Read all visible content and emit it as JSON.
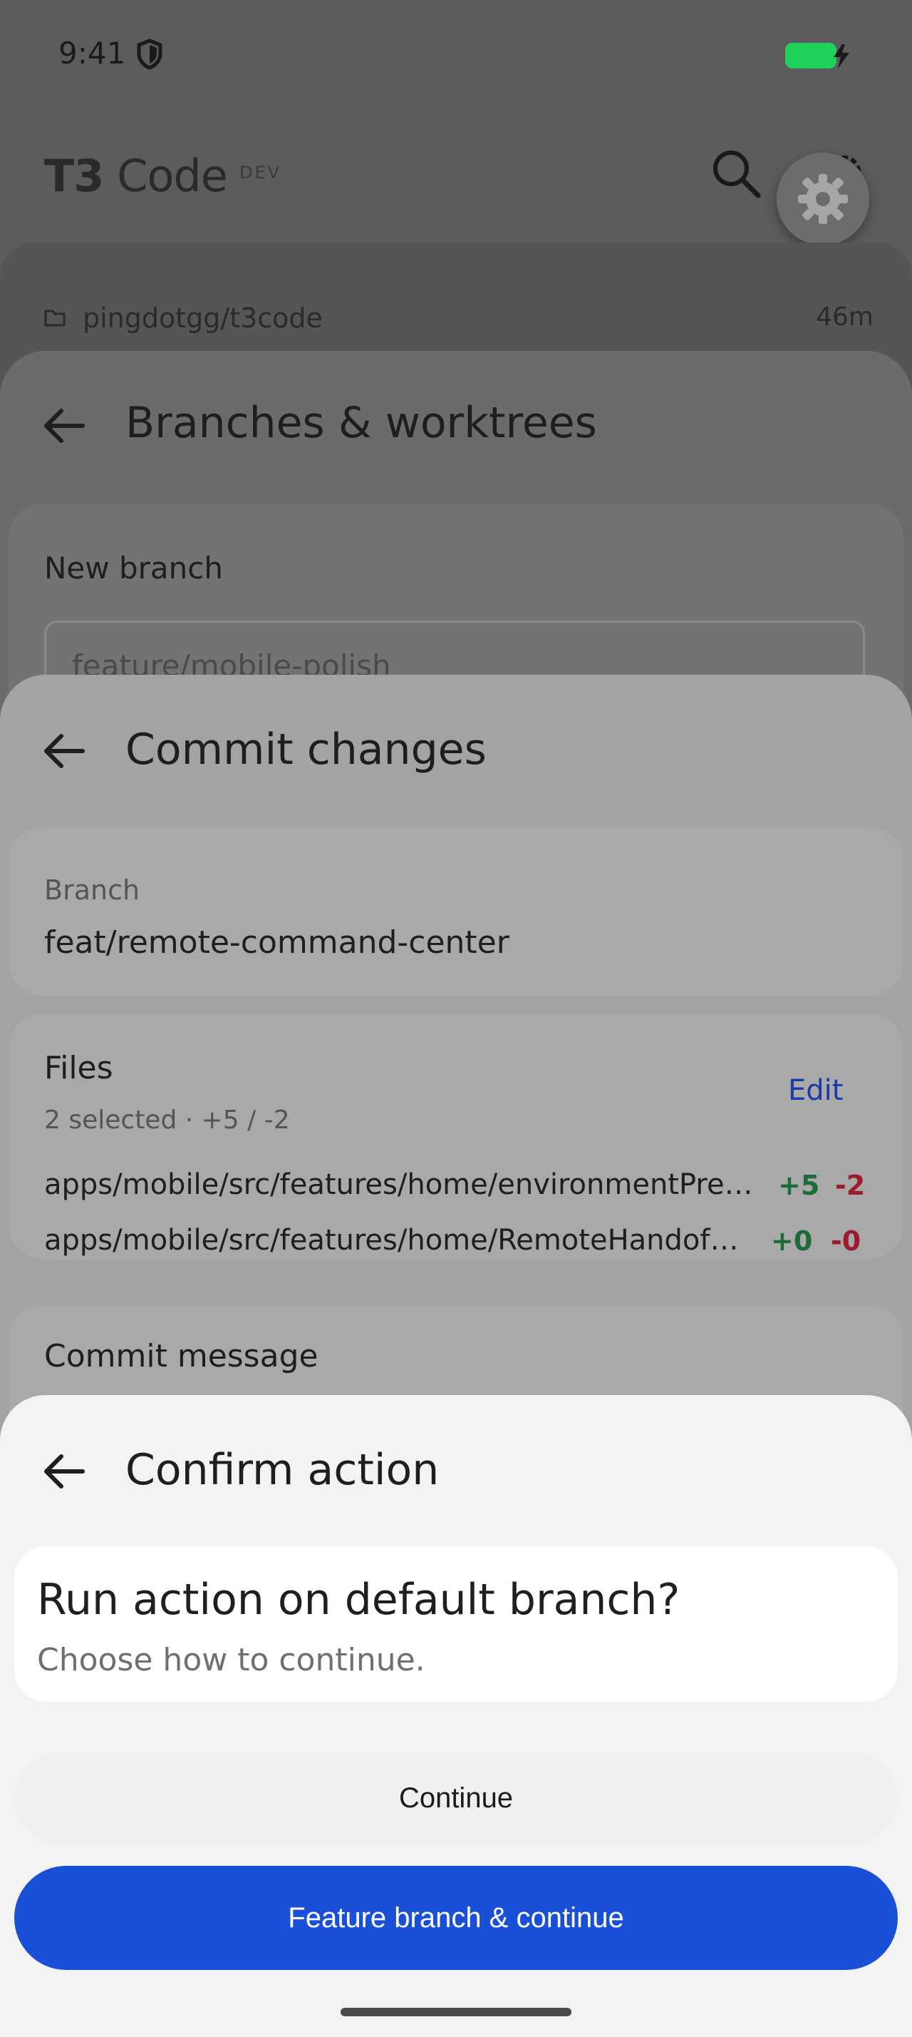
{
  "status_bar": {
    "time": "9:41",
    "battery_color": "#1fd15a"
  },
  "app": {
    "brand_strong": "T3",
    "brand_rest": "Code",
    "env_badge": "DEV"
  },
  "repo_card": {
    "repo": "pingdotgg/t3code",
    "age": "46m"
  },
  "branches_sheet": {
    "title": "Branches & worktrees",
    "new_branch_label": "New branch",
    "new_branch_value": "feature/mobile-polish"
  },
  "commit_sheet": {
    "title": "Commit changes",
    "branch_label": "Branch",
    "branch_value": "feat/remote-command-center",
    "files_label": "Files",
    "files_summary": "2 selected · +5 / -2",
    "edit_label": "Edit",
    "files": [
      {
        "path": "apps/mobile/src/features/home/environmentPre…",
        "add": "+5",
        "del": "-2"
      },
      {
        "path": "apps/mobile/src/features/home/RemoteHandof…",
        "add": "+0",
        "del": "-0"
      }
    ],
    "commit_message_label": "Commit message"
  },
  "confirm_sheet": {
    "title": "Confirm action",
    "question": "Run action on default branch?",
    "subtitle": "Choose how to continue.",
    "continue_label": "Continue",
    "feature_branch_label": "Feature branch & continue"
  },
  "colors": {
    "primary": "#1a4fd8",
    "additions": "#1e6b3a",
    "deletions": "#9e1b2e"
  }
}
